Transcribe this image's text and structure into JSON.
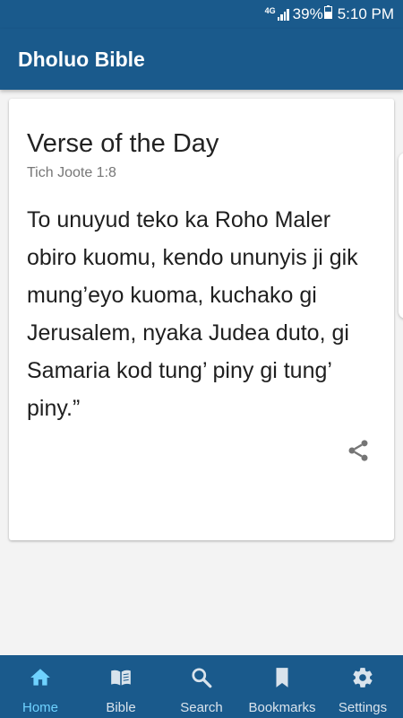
{
  "status": {
    "network": "4G",
    "battery": "39%",
    "time": "5:10 PM"
  },
  "app": {
    "title": "Dholuo Bible"
  },
  "verse_card": {
    "heading": "Verse of the Day",
    "reference": "Tich Joote 1:8",
    "text": "To unuyud teko ka Roho Maler obiro kuomu, kendo ununyis ji gik mung’eyo kuoma, kuchako gi Jerusalem, nyaka Judea duto, gi Samaria kod tung’ piny gi tung’ piny.”",
    "share_icon": "share-icon"
  },
  "bottom_nav": {
    "active": "Home",
    "items": [
      {
        "label": "Home",
        "icon": "home-icon"
      },
      {
        "label": "Bible",
        "icon": "book-icon"
      },
      {
        "label": "Search",
        "icon": "search-icon"
      },
      {
        "label": "Bookmarks",
        "icon": "bookmark-icon"
      },
      {
        "label": "Settings",
        "icon": "gear-icon"
      }
    ]
  },
  "colors": {
    "primary": "#1a5a8c",
    "active_nav": "#6fd2ff",
    "background": "#f3f3f3"
  }
}
